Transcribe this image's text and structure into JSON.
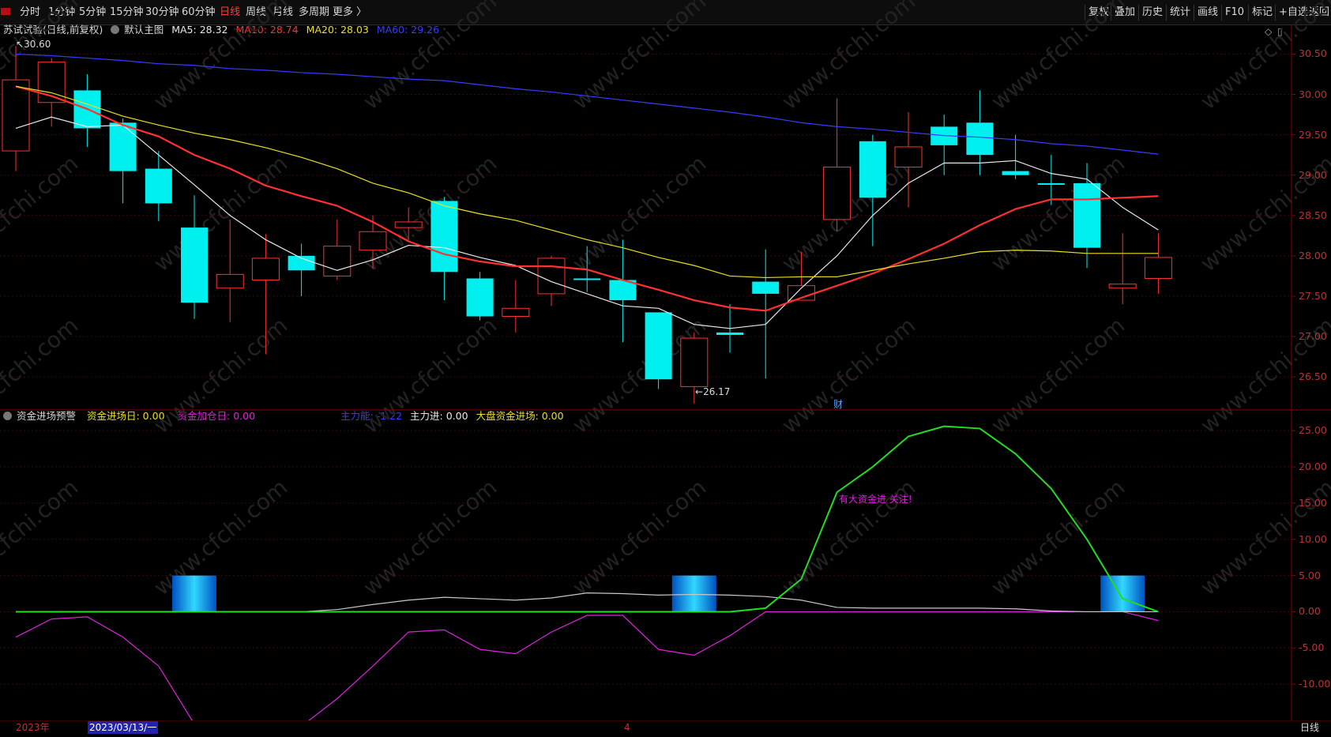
{
  "toolbar": {
    "periods": [
      "分时",
      "1分钟",
      "5分钟",
      "15分钟",
      "30分钟",
      "60分钟",
      "日线",
      "周线",
      "月线",
      "多周期",
      "更多 〉"
    ],
    "active_period": "日线",
    "right_buttons": [
      "复权",
      "叠加",
      "历史",
      "统计",
      "画线",
      "F10",
      "标记",
      "+自选",
      "返回"
    ]
  },
  "main_header": {
    "title": "苏试试验(日线,前复权)",
    "indicator_name": "默认主图",
    "ma5": {
      "label": "MA5: 28.32",
      "color": "#e8e8e8"
    },
    "ma10": {
      "label": "MA10: 28.74",
      "color": "#ff3030"
    },
    "ma20": {
      "label": "MA20: 28.03",
      "color": "#e8e020"
    },
    "ma60": {
      "label": "MA60: 29.26",
      "color": "#3a3aff"
    }
  },
  "sub_header": {
    "indicator_name": "资金进场预警",
    "items": [
      {
        "label": "资金进场日: 0.00",
        "color": "#e8e020"
      },
      {
        "label": "资金加仓日: 0.00",
        "color": "#e020e0"
      },
      {
        "label": "主力能: -1.22",
        "color": "#3a3aff"
      },
      {
        "label": "主力进: 0.00",
        "color": "#e8e8e8"
      },
      {
        "label": "大盘资金进场: 0.00",
        "color": "#e8e020"
      }
    ]
  },
  "main_axis_labels": [
    "30.50",
    "30.00",
    "29.50",
    "29.00",
    "28.50",
    "28.00",
    "27.50",
    "27.00",
    "26.50"
  ],
  "sub_axis_labels": [
    "25.00",
    "20.00",
    "15.00",
    "10.00",
    "5.00",
    "0.00",
    "-5.00",
    "-10.00"
  ],
  "annotations": {
    "high_label": "30.60",
    "low_label": "26.17",
    "finance_marker": "财",
    "alert_text": "有大资金进 关注!"
  },
  "bottom": {
    "year_label": "2023年",
    "cursor_date": "2023/03/13/一",
    "month_marker": "4",
    "period_label": "日线"
  },
  "watermark": "www.cfchi.com",
  "chart_data": [
    {
      "type": "candlestick",
      "ylim": [
        26.1,
        30.7
      ],
      "candles": [
        {
          "o": 29.3,
          "c": 30.18,
          "h": 30.6,
          "l": 29.05
        },
        {
          "o": 29.9,
          "c": 30.4,
          "h": 30.45,
          "l": 29.6
        },
        {
          "o": 30.05,
          "c": 29.58,
          "h": 30.25,
          "l": 29.35
        },
        {
          "o": 29.65,
          "c": 29.05,
          "h": 29.7,
          "l": 28.65
        },
        {
          "o": 29.08,
          "c": 28.65,
          "h": 29.3,
          "l": 28.43
        },
        {
          "o": 28.35,
          "c": 27.42,
          "h": 28.75,
          "l": 27.22
        },
        {
          "o": 27.6,
          "c": 27.77,
          "h": 28.45,
          "l": 27.18
        },
        {
          "o": 27.7,
          "c": 27.97,
          "h": 28.27,
          "l": 26.78
        },
        {
          "o": 28.0,
          "c": 27.82,
          "h": 28.15,
          "l": 27.5
        },
        {
          "o": 27.75,
          "c": 28.12,
          "h": 28.45,
          "l": 27.7
        },
        {
          "o": 28.07,
          "c": 28.3,
          "h": 28.5,
          "l": 27.84
        },
        {
          "o": 28.35,
          "c": 28.42,
          "h": 28.6,
          "l": 28.2
        },
        {
          "o": 28.68,
          "c": 27.8,
          "h": 28.73,
          "l": 27.45
        },
        {
          "o": 27.72,
          "c": 27.25,
          "h": 27.8,
          "l": 27.2
        },
        {
          "o": 27.25,
          "c": 27.35,
          "h": 27.7,
          "l": 27.05
        },
        {
          "o": 27.53,
          "c": 27.97,
          "h": 28.0,
          "l": 27.38
        },
        {
          "o": 27.72,
          "c": 27.7,
          "h": 28.12,
          "l": 27.55
        },
        {
          "o": 27.7,
          "c": 27.45,
          "h": 28.2,
          "l": 26.93
        },
        {
          "o": 27.3,
          "c": 26.47,
          "h": 27.3,
          "l": 26.35
        },
        {
          "o": 26.38,
          "c": 26.98,
          "h": 27.05,
          "l": 26.17
        },
        {
          "o": 27.05,
          "c": 27.02,
          "h": 27.4,
          "l": 26.8
        },
        {
          "o": 27.68,
          "c": 27.53,
          "h": 28.08,
          "l": 26.48
        },
        {
          "o": 27.45,
          "c": 27.63,
          "h": 28.05,
          "l": 27.45
        },
        {
          "o": 28.45,
          "c": 29.1,
          "h": 29.95,
          "l": 28.3
        },
        {
          "o": 29.42,
          "c": 28.72,
          "h": 29.5,
          "l": 28.12
        },
        {
          "o": 29.1,
          "c": 29.35,
          "h": 29.78,
          "l": 28.6
        },
        {
          "o": 29.6,
          "c": 29.37,
          "h": 29.75,
          "l": 29.0
        },
        {
          "o": 29.65,
          "c": 29.25,
          "h": 30.05,
          "l": 29.0
        },
        {
          "o": 29.05,
          "c": 29.0,
          "h": 29.5,
          "l": 28.95
        },
        {
          "o": 28.9,
          "c": 28.88,
          "h": 29.25,
          "l": 28.63
        },
        {
          "o": 28.9,
          "c": 28.1,
          "h": 29.15,
          "l": 27.85
        },
        {
          "o": 27.6,
          "c": 27.65,
          "h": 28.28,
          "l": 27.4
        },
        {
          "o": 27.72,
          "c": 27.98,
          "h": 28.28,
          "l": 27.53
        }
      ],
      "series": [
        {
          "name": "MA5",
          "color": "#e8e8e8",
          "values": [
            29.58,
            29.72,
            29.6,
            29.62,
            29.25,
            28.88,
            28.5,
            28.2,
            27.97,
            27.82,
            27.95,
            28.13,
            28.1,
            27.98,
            27.88,
            27.68,
            27.53,
            27.38,
            27.35,
            27.15,
            27.1,
            27.15,
            27.6,
            28.0,
            28.5,
            28.9,
            29.15,
            29.15,
            29.18,
            29.02,
            28.95,
            28.6,
            28.32
          ]
        },
        {
          "name": "MA10",
          "color": "#ff3030",
          "values": [
            30.1,
            29.98,
            29.82,
            29.62,
            29.48,
            29.25,
            29.08,
            28.87,
            28.74,
            28.62,
            28.42,
            28.18,
            28.02,
            27.93,
            27.87,
            27.87,
            27.83,
            27.7,
            27.58,
            27.45,
            27.36,
            27.32,
            27.48,
            27.63,
            27.78,
            27.96,
            28.15,
            28.38,
            28.58,
            28.7,
            28.7,
            28.72,
            28.74
          ]
        },
        {
          "name": "MA20",
          "color": "#e8e020",
          "values": [
            30.1,
            30.02,
            29.88,
            29.73,
            29.62,
            29.52,
            29.44,
            29.34,
            29.22,
            29.08,
            28.9,
            28.78,
            28.62,
            28.52,
            28.44,
            28.32,
            28.2,
            28.1,
            27.98,
            27.88,
            27.75,
            27.73,
            27.74,
            27.74,
            27.82,
            27.9,
            27.97,
            28.05,
            28.07,
            28.06,
            28.03,
            28.03,
            28.03
          ]
        },
        {
          "name": "MA60",
          "color": "#3a3aff",
          "values": [
            30.5,
            30.48,
            30.45,
            30.42,
            30.38,
            30.36,
            30.32,
            30.3,
            30.27,
            30.25,
            30.22,
            30.19,
            30.17,
            30.12,
            30.07,
            30.03,
            29.98,
            29.93,
            29.88,
            29.83,
            29.78,
            29.72,
            29.65,
            29.6,
            29.57,
            29.53,
            29.49,
            29.47,
            29.44,
            29.39,
            29.36,
            29.31,
            29.26
          ]
        }
      ]
    },
    {
      "type": "line",
      "ylim": [
        -15,
        26
      ],
      "series": [
        {
          "name": "主力能",
          "color": "#e020e0",
          "values": [
            -3.5,
            -1.0,
            -0.7,
            -3.5,
            -7.5,
            -15.5,
            -17.5,
            -17.5,
            -15.8,
            -12.0,
            -7.5,
            -2.8,
            -2.5,
            -5.2,
            -5.8,
            -2.8,
            -0.5,
            -0.5,
            -5.2,
            -6.0,
            -3.3,
            0,
            0,
            0,
            0,
            0,
            0,
            0,
            0,
            0,
            0,
            0,
            -1.22
          ]
        },
        {
          "name": "主力进",
          "color": "#c8c8c8",
          "values": [
            0,
            0,
            0,
            0,
            0,
            0,
            0,
            0,
            0,
            0.3,
            1.0,
            1.6,
            2.0,
            1.8,
            1.6,
            1.9,
            2.6,
            2.5,
            2.3,
            2.4,
            2.3,
            2.1,
            1.6,
            0.6,
            0.5,
            0.5,
            0.5,
            0.5,
            0.4,
            0.1,
            0,
            0,
            0
          ]
        },
        {
          "name": "大盘资金进场",
          "color": "#22dd22",
          "values": [
            0,
            0,
            0,
            0,
            0,
            0,
            0,
            0,
            0,
            0,
            0,
            0,
            0,
            0,
            0,
            0,
            0,
            0,
            0,
            0,
            0,
            0.5,
            4.5,
            16.5,
            20,
            24.2,
            25.6,
            25.3,
            21.8,
            17,
            10,
            1.8,
            0
          ]
        }
      ],
      "bars": [
        {
          "index": 5,
          "value": 5
        },
        {
          "index": 19,
          "value": 5
        },
        {
          "index": 31,
          "value": 5
        }
      ]
    }
  ]
}
